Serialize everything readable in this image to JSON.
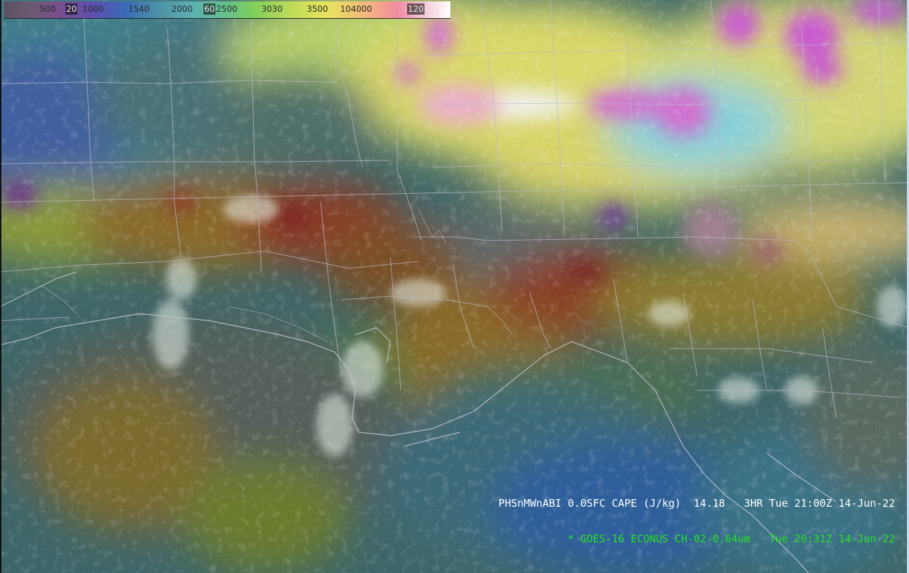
{
  "colorbar": {
    "labels": [
      {
        "text": "500",
        "dark": false
      },
      {
        "text": "20",
        "dark": true
      },
      {
        "text": "1000",
        "dark": false
      },
      {
        "text": "1540",
        "dark": false
      },
      {
        "text": "2000",
        "dark": false
      },
      {
        "text": "60",
        "dark": true
      },
      {
        "text": "2500",
        "dark": false
      },
      {
        "text": "3030",
        "dark": false
      },
      {
        "text": "3500",
        "dark": false
      },
      {
        "text": "104000",
        "dark": false
      },
      {
        "text": "120",
        "dark": true
      }
    ]
  },
  "readout": {
    "line1": "PHSnMWnABI 0.0SFC CAPE (J/kg)  14.18   3HR Tue 21:00Z 14-Jun-22",
    "line2": "* GOES-16 ECONUS CH-02-0.64um   Tue 20:31Z 14-Jun-22"
  },
  "colors": {
    "line1": "#ffffff",
    "line2": "#27e227",
    "boundaries": "#b9b9c8"
  }
}
